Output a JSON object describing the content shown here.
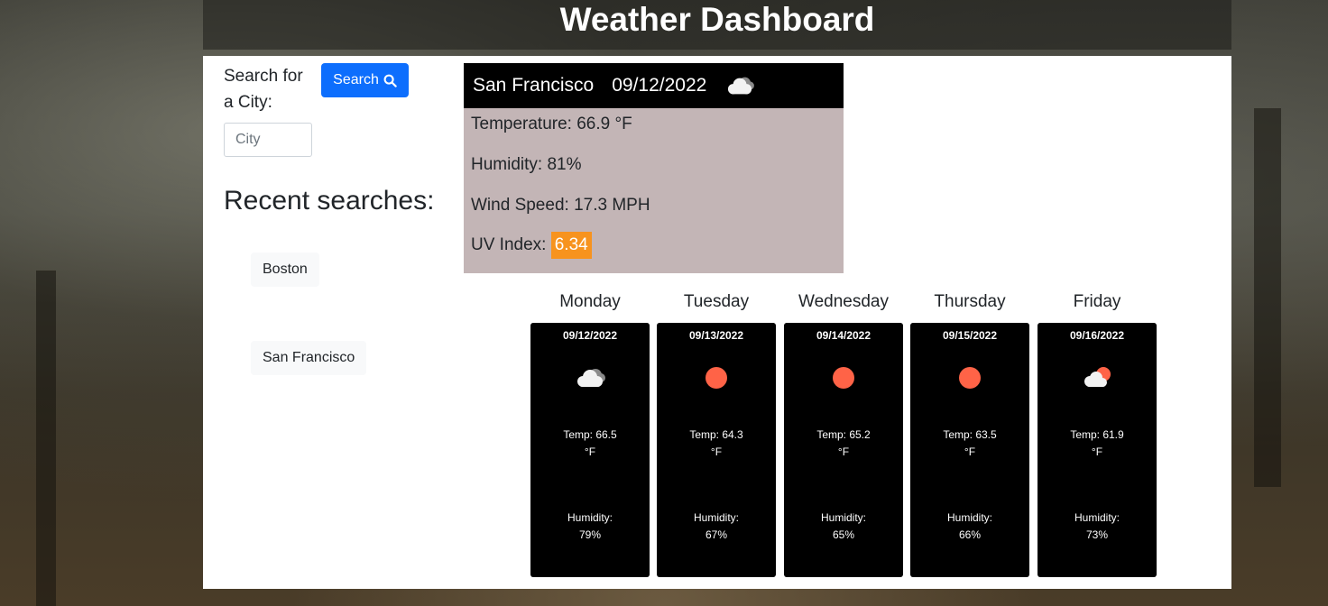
{
  "header": {
    "title": "Weather Dashboard"
  },
  "search": {
    "label": "Search for a City:",
    "button_label": "Search",
    "placeholder": "City",
    "value": ""
  },
  "recent": {
    "heading": "Recent searches:",
    "items": [
      "Boston",
      "San Francisco"
    ]
  },
  "current": {
    "city": "San Francisco",
    "date": "09/12/2022",
    "icon": "cloudy-icon",
    "temperature": "Temperature: 66.9 °F",
    "humidity": "Humidity: 81%",
    "wind": "Wind Speed: 17.3 MPH",
    "uv_label": "UV Index:",
    "uv_value": "6.34",
    "uv_color": "#f7931e"
  },
  "forecast": [
    {
      "day": "Monday",
      "date": "09/12/2022",
      "icon": "cloudy-icon",
      "temp_label": "Temp: 66.5",
      "temp_unit": "°F",
      "humidity_label": "Humidity:",
      "humidity": "79%"
    },
    {
      "day": "Tuesday",
      "date": "09/13/2022",
      "icon": "sun-icon",
      "temp_label": "Temp: 64.3",
      "temp_unit": "°F",
      "humidity_label": "Humidity:",
      "humidity": "67%"
    },
    {
      "day": "Wednesday",
      "date": "09/14/2022",
      "icon": "sun-icon",
      "temp_label": "Temp: 65.2",
      "temp_unit": "°F",
      "humidity_label": "Humidity:",
      "humidity": "65%"
    },
    {
      "day": "Thursday",
      "date": "09/15/2022",
      "icon": "sun-icon",
      "temp_label": "Temp: 63.5",
      "temp_unit": "°F",
      "humidity_label": "Humidity:",
      "humidity": "66%"
    },
    {
      "day": "Friday",
      "date": "09/16/2022",
      "icon": "partly-cloudy-icon",
      "temp_label": "Temp: 61.9",
      "temp_unit": "°F",
      "humidity_label": "Humidity:",
      "humidity": "73%"
    }
  ],
  "colors": {
    "primary_button": "#0d6efd",
    "current_card_bg": "#c3b5b6",
    "forecast_card_bg": "#000000",
    "sun": "#ff6347"
  }
}
